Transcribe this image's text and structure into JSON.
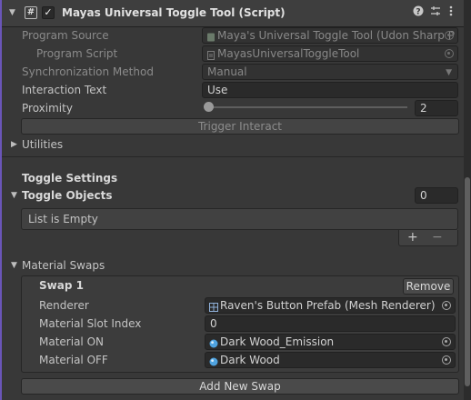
{
  "header": {
    "title": "Mayas Universal Toggle Tool (Script)",
    "checkbox_mark": "✓",
    "script_glyph": "#",
    "icons": [
      "help-icon",
      "preset-icon",
      "more-icon"
    ]
  },
  "fields": {
    "program_source_label": "Program Source",
    "program_source_value": "Maya's Universal Toggle Tool (Udon Sharp P",
    "program_script_label": "Program Script",
    "program_script_value": "MayasUniversalToggleTool",
    "sync_label": "Synchronization Method",
    "sync_value": "Manual",
    "interaction_text_label": "Interaction Text",
    "interaction_text_value": "Use",
    "proximity_label": "Proximity",
    "proximity_value": "2",
    "trigger_interact_label": "Trigger Interact"
  },
  "utilities_label": "Utilities",
  "toggle_settings": {
    "heading": "Toggle Settings",
    "objects_label": "Toggle Objects",
    "objects_count": "0",
    "list_empty": "List is Empty",
    "add_label": "+",
    "remove_label": "−"
  },
  "material_swaps": {
    "label": "Material Swaps",
    "swap_title": "Swap 1",
    "remove_label": "Remove",
    "renderer_label": "Renderer",
    "renderer_value": "Raven's Button Prefab (Mesh Renderer)",
    "slot_label": "Material Slot Index",
    "slot_value": "0",
    "on_label": "Material ON",
    "on_value": "Dark Wood_Emission",
    "off_label": "Material OFF",
    "off_value": "Dark Wood",
    "add_new_label": "Add New Swap"
  },
  "colors": {
    "background": "#383838",
    "field_bg": "#2a2a2a",
    "accent_strip": "#6a55b8",
    "material_icon": "#4fa3e0"
  }
}
